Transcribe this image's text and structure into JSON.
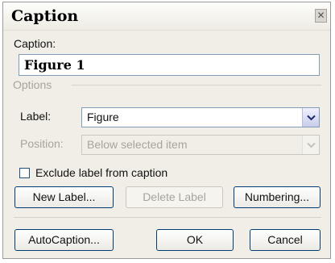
{
  "dialog": {
    "title": "Caption",
    "close_glyph": "✕"
  },
  "caption": {
    "label": "Caption:",
    "value": "Figure 1"
  },
  "options": {
    "group_label": "Options",
    "label_field": {
      "label": "Label:",
      "value": "Figure"
    },
    "position_field": {
      "label": "Position:",
      "value": "Below selected item",
      "enabled": false
    },
    "exclude_label": {
      "label": "Exclude label from caption",
      "checked": false
    }
  },
  "buttons": {
    "new_label": "New Label...",
    "delete_label": "Delete Label",
    "numbering": "Numbering...",
    "autocaption": "AutoCaption...",
    "ok": "OK",
    "cancel": "Cancel"
  },
  "icons": {
    "dropdown": "chevron-down-icon",
    "close": "close-icon"
  }
}
